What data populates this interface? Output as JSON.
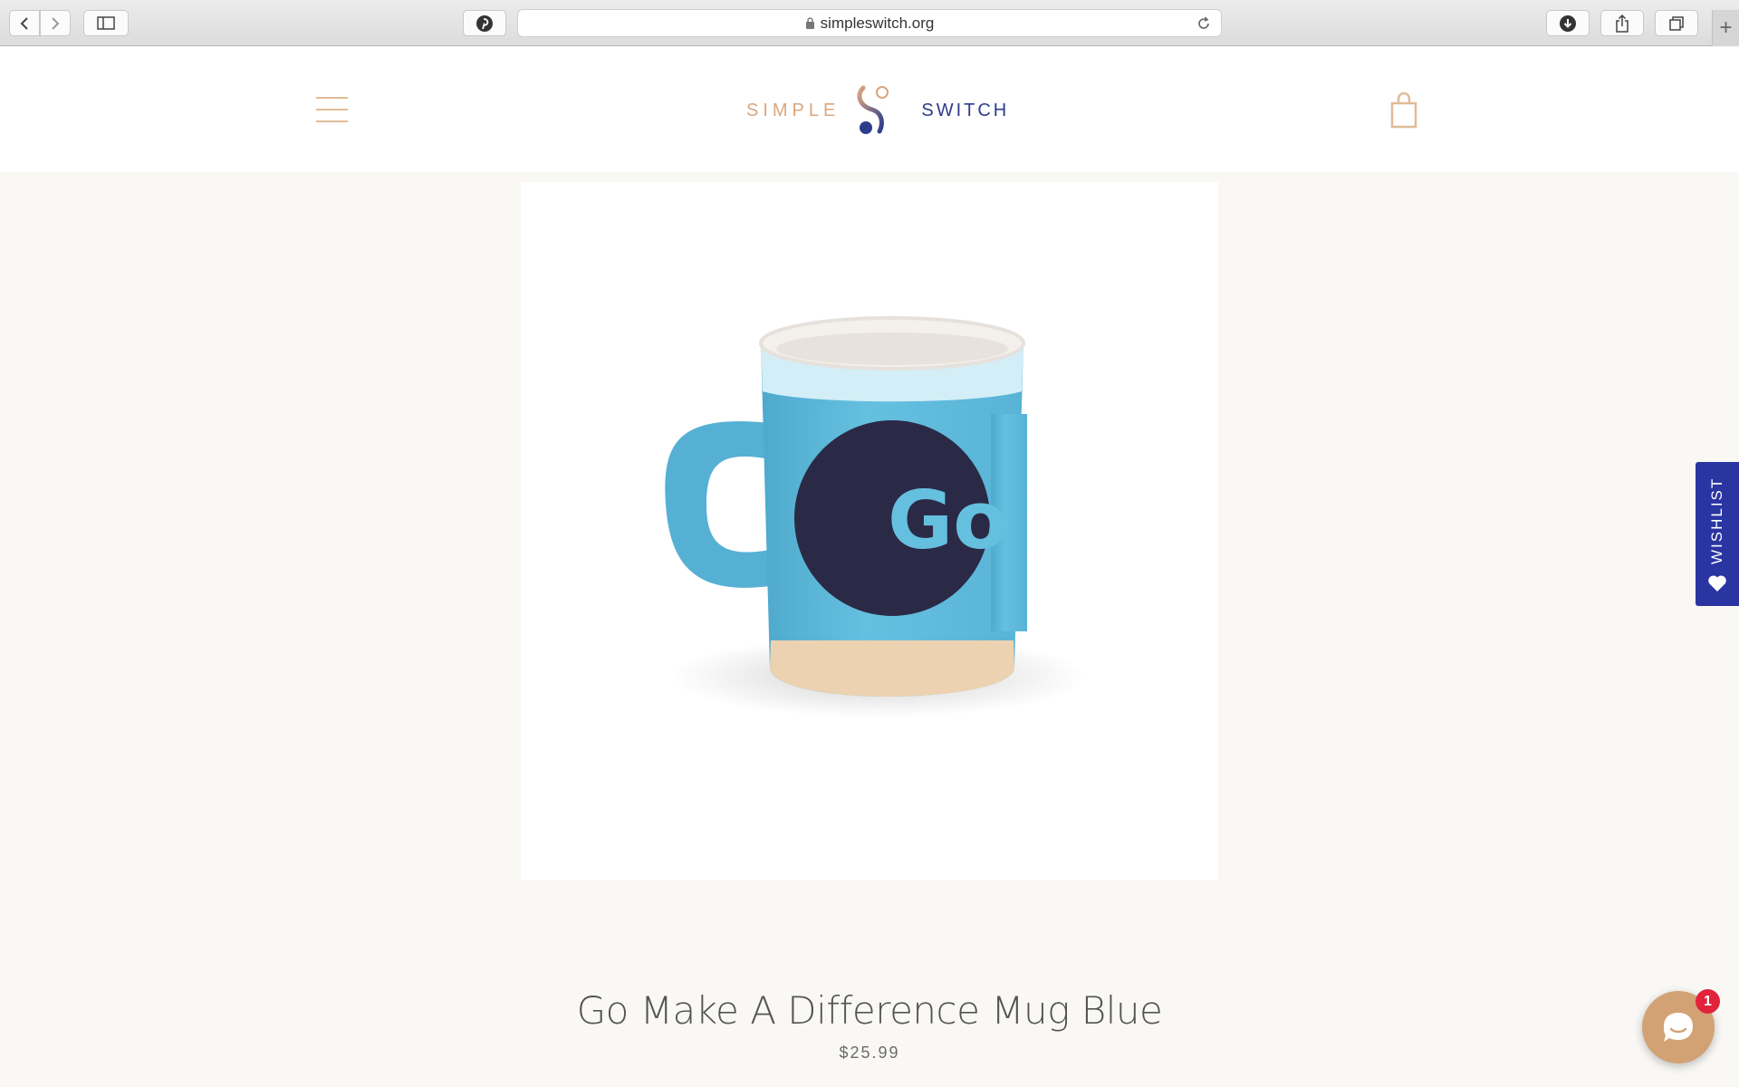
{
  "browser": {
    "url": "simpleswitch.org",
    "buttons": {
      "back": "chevron-left-icon",
      "forward": "chevron-right-icon",
      "sidebar": "sidebar-icon",
      "pinterest": "pinterest-icon",
      "download": "download-icon",
      "share": "share-icon",
      "tabs": "tabs-icon",
      "new_tab": "+"
    }
  },
  "site": {
    "logo": {
      "left": "SIMPLE",
      "right": "SWITCH"
    },
    "colors": {
      "accent": "#d9a67e",
      "brand_blue": "#2d3c8c",
      "background": "#f9f8f5"
    }
  },
  "product": {
    "title": "Go Make A Difference Mug Blue",
    "price": "$25.99",
    "image": {
      "mug_text": "Go",
      "mug_color": "#5fb9d8"
    }
  },
  "wishlist": {
    "label": "WISHLIST",
    "icon": "heart-icon",
    "color": "#2a35a2"
  },
  "chat": {
    "badge_count": "1",
    "icon": "chat-bubble-icon"
  }
}
